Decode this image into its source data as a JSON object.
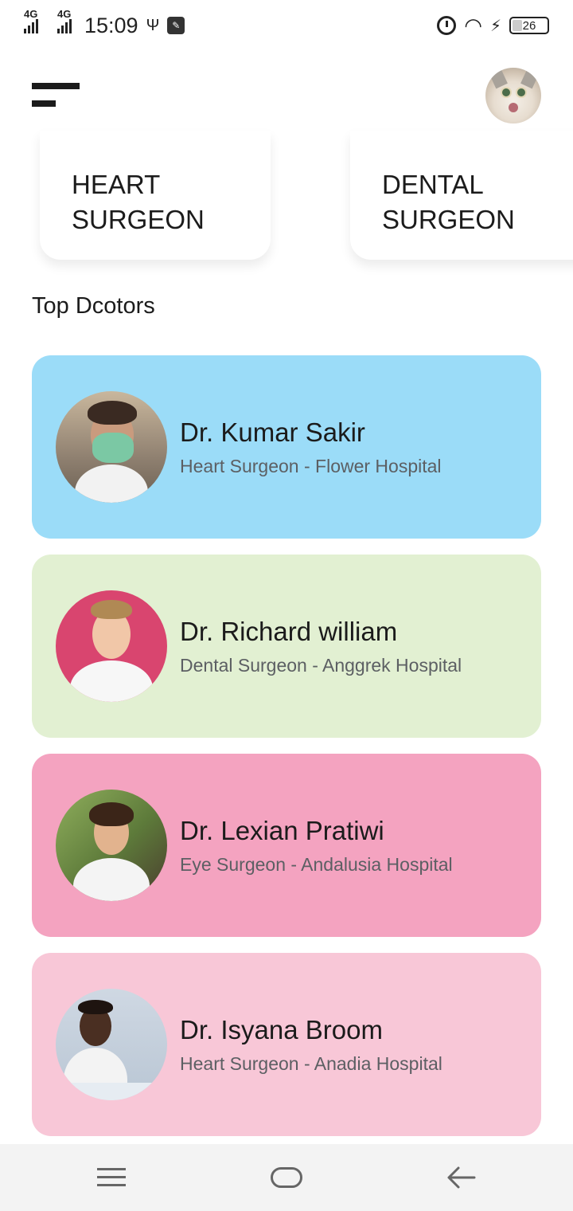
{
  "status_bar": {
    "network_1": "4G",
    "network_2": "4G",
    "time": "15:09",
    "battery": "26"
  },
  "header": {
    "menu_icon": "menu-icon",
    "avatar_icon": "cat-avatar"
  },
  "categories": [
    {
      "line1": "HEART",
      "line2": "SURGEON"
    },
    {
      "line1": "DENTAL",
      "line2": "SURGEON"
    }
  ],
  "section_title": "Top Dcotors",
  "doctors": [
    {
      "name": "Dr. Kumar Sakir",
      "subtitle": "Heart Surgeon - Flower Hospital",
      "color": "#9bdcf8"
    },
    {
      "name": "Dr. Richard william",
      "subtitle": "Dental Surgeon - Anggrek Hospital",
      "color": "#e2f0d2"
    },
    {
      "name": "Dr. Lexian Pratiwi",
      "subtitle": "Eye Surgeon - Andalusia Hospital",
      "color": "#f4a3c0"
    },
    {
      "name": "Dr. Isyana Broom",
      "subtitle": "Heart Surgeon - Anadia Hospital",
      "color": "#f8c7d7"
    }
  ],
  "nav_bar": {
    "menu": "menu-lines-icon",
    "home": "home-pill-icon",
    "back": "back-arrow-icon"
  }
}
